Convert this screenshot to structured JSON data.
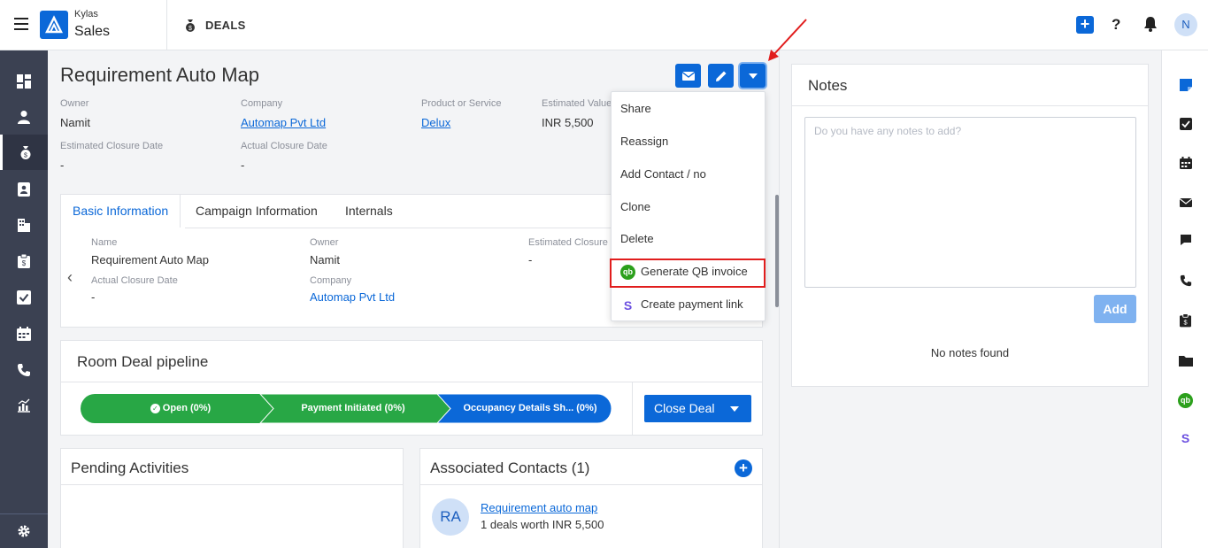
{
  "app": {
    "brand_small": "Kylas",
    "brand_big": "Sales",
    "module": "DEALS",
    "avatar_initial": "N"
  },
  "colors": {
    "primary": "#0b68d8",
    "success": "#28a745",
    "sidebar": "#3b4152",
    "highlight": "#e11d1d"
  },
  "deal": {
    "title": "Requirement Auto Map",
    "fields": {
      "owner_label": "Owner",
      "owner_value": "Namit",
      "company_label": "Company",
      "company_value": "Automap Pvt Ltd",
      "product_label": "Product or Service",
      "product_value": "Delux",
      "estvalue_label": "Estimated Value",
      "estvalue_value": "INR 5,500",
      "estclose_label": "Estimated Closure Date",
      "estclose_value": "-",
      "actclose_label": "Actual Closure Date",
      "actclose_value": "-"
    }
  },
  "tabs": {
    "items": [
      "Basic Information",
      "Campaign Information",
      "Internals"
    ],
    "basic": {
      "name_label": "Name",
      "name_value": "Requirement Auto Map",
      "owner_label": "Owner",
      "owner_value": "Namit",
      "estclose_label": "Estimated Closure",
      "estclose_value": "-",
      "actclose_label": "Actual Closure Date",
      "actclose_value": "-",
      "company_label": "Company",
      "company_value": "Automap Pvt Ltd"
    }
  },
  "pipeline": {
    "title": "Room Deal pipeline",
    "stages": [
      "Open (0%)",
      "Payment Initiated (0%)",
      "Occupancy Details Sh...  (0%)"
    ],
    "close_deal": "Close Deal"
  },
  "dropdown": {
    "items": [
      "Share",
      "Reassign",
      "Add Contact / no",
      "Clone",
      "Delete",
      "Generate QB invoice",
      "Create payment link"
    ],
    "qb_icon_text": "qb",
    "stripe_icon_text": "S"
  },
  "pending": {
    "title": "Pending Activities"
  },
  "contacts": {
    "title": "Associated Contacts (1)",
    "items": [
      {
        "initials": "RA",
        "name": "Requirement auto map",
        "summary": "1 deals worth INR 5,500"
      }
    ]
  },
  "notes": {
    "title": "Notes",
    "placeholder": "Do you have any notes to add?",
    "add_label": "Add",
    "empty": "No notes found"
  },
  "right_qb_icon_text": "qb",
  "right_stripe_icon_text": "S"
}
